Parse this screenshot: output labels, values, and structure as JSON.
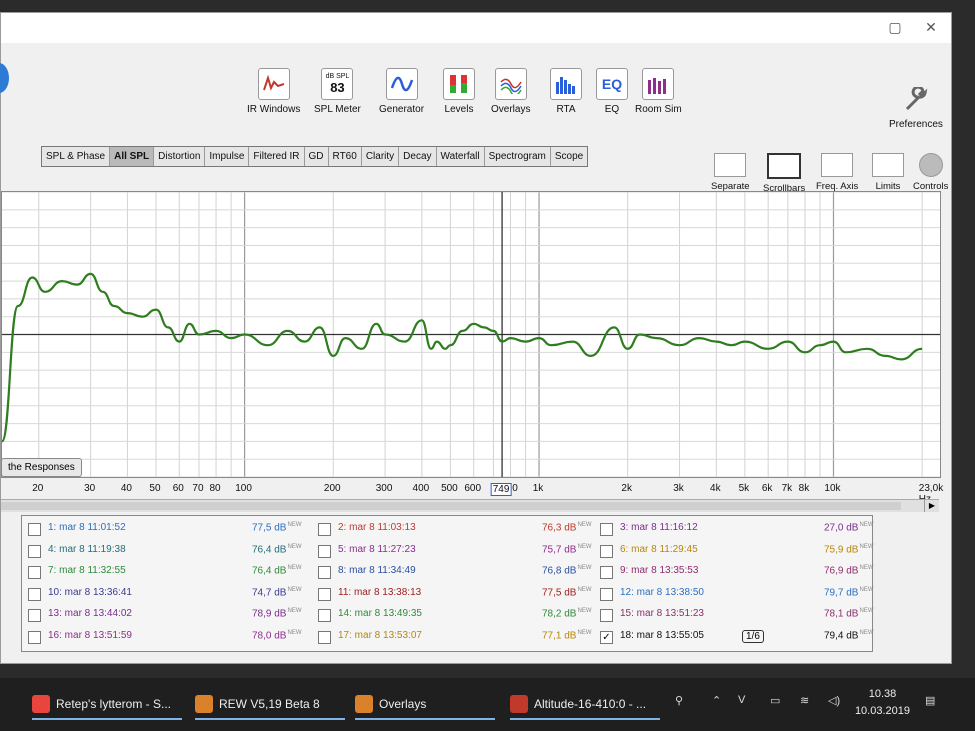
{
  "toolbar": {
    "items": [
      {
        "label": "IR Windows"
      },
      {
        "label": "SPL Meter",
        "mini": "dB SPL",
        "value": "83"
      },
      {
        "label": "Generator"
      },
      {
        "label": "Levels"
      },
      {
        "label": "Overlays"
      },
      {
        "label": "RTA"
      },
      {
        "label": "EQ",
        "icon_text": "EQ"
      },
      {
        "label": "Room Sim"
      }
    ],
    "preferences": "Preferences"
  },
  "tabs": [
    "SPL & Phase",
    "All SPL",
    "Distortion",
    "Impulse",
    "Filtered IR",
    "GD",
    "RT60",
    "Clarity",
    "Decay",
    "Waterfall",
    "Spectrogram",
    "Scope"
  ],
  "active_tab": "All SPL",
  "right_tools": [
    "Separate",
    "Scrollbars",
    "Freq. Axis",
    "Limits",
    "Controls"
  ],
  "plot": {
    "responses_button": "the Responses",
    "freq_ticks": [
      "20",
      "30",
      "40",
      "50",
      "60",
      "70",
      "80",
      "100",
      "200",
      "300",
      "400",
      "500",
      "600",
      "749",
      "1k",
      "2k",
      "3k",
      "4k",
      "5k",
      "6k",
      "7k",
      "8k",
      "10k",
      "23,0k Hz"
    ],
    "cursor_value": "749",
    "cursor_suffix": "0",
    "curve_color": "#2e7d1f"
  },
  "chart_data": {
    "type": "line",
    "x_scale": "log",
    "xlim": [
      15,
      23000
    ],
    "series": [
      {
        "x": [
          15,
          17,
          19,
          21,
          24,
          27,
          30,
          33,
          36,
          40,
          45,
          50,
          55,
          60,
          65,
          70,
          80,
          90,
          100,
          120,
          140,
          160,
          180,
          200,
          220,
          250,
          280,
          300,
          350,
          400,
          430,
          450,
          480,
          500,
          550,
          600,
          650,
          700,
          750,
          800,
          900,
          1000,
          1100,
          1300,
          1500,
          1800,
          2000,
          2200,
          2500,
          3000,
          3500,
          4000,
          4500,
          5000,
          6000,
          7000,
          8000,
          9000,
          10000,
          11000,
          13000,
          15000,
          17000,
          20000
        ],
        "y": [
          -30,
          8,
          16,
          12,
          15,
          14,
          17,
          12,
          8,
          6,
          5,
          7,
          2,
          -2,
          3,
          0,
          1,
          -1,
          0,
          -3,
          1,
          -2,
          2,
          -6,
          -1,
          -4,
          3,
          0,
          -2,
          4,
          -4,
          -2,
          -4,
          -3,
          1,
          3,
          2,
          1,
          -2,
          -1,
          -2,
          -1,
          -3,
          -2,
          -6,
          2,
          -4,
          0,
          -1,
          -3,
          -1,
          -2,
          -3,
          -2,
          -4,
          -2,
          -5,
          -3,
          -2,
          -5,
          -4,
          -6,
          -7,
          -4
        ]
      }
    ]
  },
  "legend": [
    {
      "name": "1: mar 8 11:01:52",
      "value": "77,5 dB",
      "tag": "NEW",
      "color": "#2b6fc0",
      "checked": false
    },
    {
      "name": "2: mar 8 11:03:13",
      "value": "76,3 dB",
      "tag": "NEW",
      "color": "#c0392b",
      "checked": false
    },
    {
      "name": "3: mar 8 11:16:12",
      "value": "27,0 dB",
      "tag": "NEW",
      "color": "#7b2d8e",
      "checked": false
    },
    {
      "name": "4: mar 8 11:19:38",
      "value": "76,4 dB",
      "tag": "NEW",
      "color": "#1f6e7a",
      "checked": false
    },
    {
      "name": "5: mar 8 11:27:23",
      "value": "75,7 dB",
      "tag": "NEW",
      "color": "#8e2d8e",
      "checked": false
    },
    {
      "name": "6: mar 8 11:29:45",
      "value": "75,9 dB",
      "tag": "NEW",
      "color": "#b8860b",
      "checked": false
    },
    {
      "name": "7: mar 8 11:32:55",
      "value": "76,4 dB",
      "tag": "NEW",
      "color": "#2f8a3a",
      "checked": false
    },
    {
      "name": "8: mar 8 11:34:49",
      "value": "76,8 dB",
      "tag": "NEW",
      "color": "#2b4fa0",
      "checked": false
    },
    {
      "name": "9: mar 8 13:35:53",
      "value": "76,9 dB",
      "tag": "NEW",
      "color": "#8e2d6e",
      "checked": false
    },
    {
      "name": "10: mar 8 13:36:41",
      "value": "74,7 dB",
      "tag": "NEW",
      "color": "#3a3a8e",
      "checked": false
    },
    {
      "name": "11: mar 8 13:38:13",
      "value": "77,5 dB",
      "tag": "NEW",
      "color": "#a02020",
      "checked": false
    },
    {
      "name": "12: mar 8 13:38:50",
      "value": "79,7 dB",
      "tag": "NEW",
      "color": "#2b6fc0",
      "checked": false
    },
    {
      "name": "13: mar 8 13:44:02",
      "value": "78,9 dB",
      "tag": "NEW",
      "color": "#7b2d8e",
      "checked": false
    },
    {
      "name": "14: mar 8 13:49:35",
      "value": "78,2 dB",
      "tag": "NEW",
      "color": "#2f8a3a",
      "checked": false
    },
    {
      "name": "15: mar 8 13:51:23",
      "value": "78,1 dB",
      "tag": "NEW",
      "color": "#8e2d6e",
      "checked": false
    },
    {
      "name": "16: mar 8 13:51:59",
      "value": "78,0 dB",
      "tag": "NEW",
      "color": "#8e2d8e",
      "checked": false
    },
    {
      "name": "17: mar 8 13:53:07",
      "value": "77,1 dB",
      "tag": "NEW",
      "color": "#b8860b",
      "checked": false
    },
    {
      "name": "18: mar 8 13:55:05",
      "value": "79,4 dB",
      "tag": "NEW",
      "color": "#111111",
      "checked": true,
      "extra": "1/6"
    }
  ],
  "taskbar": {
    "tasks": [
      {
        "label": "Retep's lytterom - S...",
        "icon": "chrome-icon",
        "color": "#e8453c"
      },
      {
        "label": "REW V5,19 Beta 8",
        "icon": "java-icon",
        "color": "#d9822b"
      },
      {
        "label": "Overlays",
        "icon": "java-icon",
        "color": "#d9822b"
      },
      {
        "label": "Altitude-16-410:0 - ...",
        "icon": "vc-icon",
        "color": "#c0392b"
      }
    ],
    "time": "10.38",
    "date": "10.03.2019"
  }
}
